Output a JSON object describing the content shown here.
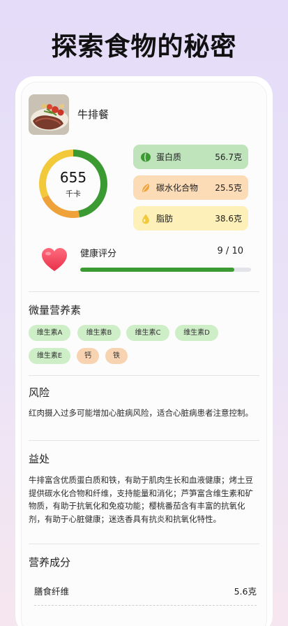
{
  "page": {
    "headline": "探索食物的秘密"
  },
  "meal": {
    "name": "牛排餐",
    "photo_icon": "steak-meal-photo"
  },
  "calories": {
    "value": "655",
    "unit": "千卡"
  },
  "macros": [
    {
      "label": "蛋白质",
      "value": "56.7克",
      "icon": "bean-icon",
      "color": "#3c9a32"
    },
    {
      "label": "碳水化合物",
      "value": "25.5克",
      "icon": "grain-icon",
      "color": "#f0a23a"
    },
    {
      "label": "脂肪",
      "value": "38.6克",
      "icon": "drop-icon",
      "color": "#f3c93c"
    }
  ],
  "health": {
    "label": "健康评分",
    "score_text": "9 / 10",
    "score_fraction": 0.9,
    "icon": "heart-icon"
  },
  "micronutrients": {
    "title": "微量营养素",
    "items": [
      "维生素A",
      "维生素B",
      "维生素C",
      "维生素D",
      "维生素E",
      "钙",
      "铁"
    ]
  },
  "risk": {
    "title": "风险",
    "text": "红肉摄入过多可能增加心脏病风险，适合心脏病患者注意控制。"
  },
  "benefit": {
    "title": "益处",
    "text": "牛排富含优质蛋白质和铁，有助于肌肉生长和血液健康；烤土豆提供碳水化合物和纤维，支持能量和消化；芦笋富含维生素和矿物质，有助于抗氧化和免疫功能；樱桃番茄含有丰富的抗氧化剂，有助于心脏健康；迷迭香具有抗炎和抗氧化特性。"
  },
  "nutrition": {
    "title": "营养成分",
    "rows": [
      {
        "label": "膳食纤维",
        "value": "5.6克"
      }
    ]
  },
  "colors": {
    "protein": "#3c9a32",
    "carb": "#f0a23a",
    "fat": "#f3c93c",
    "score_fill": "#3c9a32",
    "chip_green": "#cdeec6",
    "chip_orange": "#f7d3b1"
  }
}
